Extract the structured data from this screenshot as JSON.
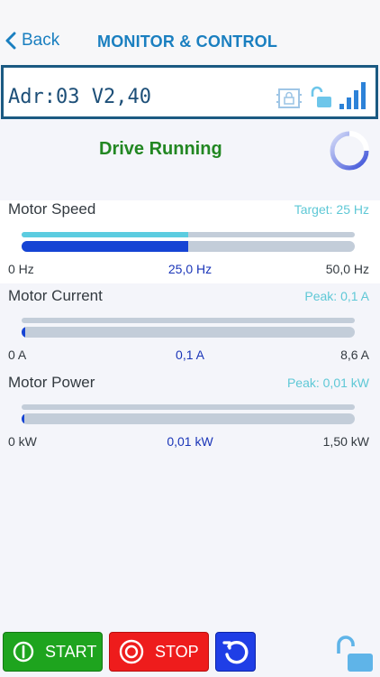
{
  "nav": {
    "back_label": "Back",
    "title": "MONITOR & CONTROL"
  },
  "device": {
    "address": "Adr:03 V2,40",
    "signal_bars": 4
  },
  "status": {
    "text": "Drive Running"
  },
  "meters": [
    {
      "title": "Motor Speed",
      "peak": "Target: 25 Hz",
      "min": "0 Hz",
      "value": "25,0 Hz",
      "max": "50,0 Hz",
      "fill": 0.5,
      "target_fill": 0.5
    },
    {
      "title": "Motor Current",
      "peak": "Peak:  0,1 A",
      "min": "0 A",
      "value": "0,1 A",
      "max": "8,6 A",
      "fill": 0.012,
      "target_fill": 0.0
    },
    {
      "title": "Motor Power",
      "peak": "Peak: 0,01 kW",
      "min": "0 kW",
      "value": "0,01 kW",
      "max": "1,50 kW",
      "fill": 0.007,
      "target_fill": 0.0
    }
  ],
  "buttons": {
    "start_label": "START",
    "stop_label": "STOP"
  },
  "colors": {
    "accent": "#1a7fc0",
    "running": "#228722",
    "start": "#1ea41e",
    "stop": "#ee1c1c",
    "reset": "#1f3ee6"
  }
}
